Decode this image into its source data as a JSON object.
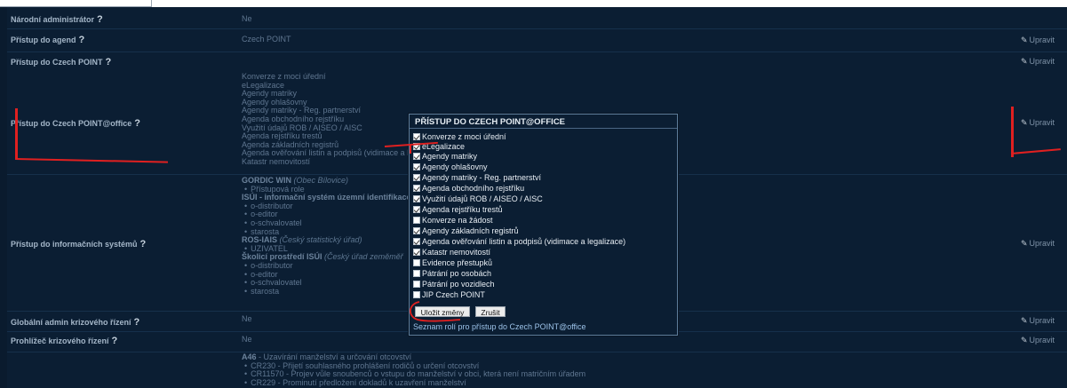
{
  "rows": {
    "narodni_admin": {
      "label": "Národní administrátor",
      "value": "Ne"
    },
    "pristup_agend": {
      "label": "Přístup do agend",
      "value": "Czech POINT",
      "edit": "Upravit"
    },
    "pristup_cp": {
      "label": "Přístup do Czech POINT",
      "edit": "Upravit"
    },
    "pristup_office": {
      "label": "Přístup do Czech POINT@office",
      "edit": "Upravit",
      "values": [
        "Konverze z moci úřední",
        "eLegalizace",
        "Agendy matriky",
        "Agendy ohlašovny",
        "Agendy matriky - Reg. partnerství",
        "Agenda obchodního rejstříku",
        "Využití údajů ROB / AISEO / AISC",
        "Agenda rejstříku trestů",
        "Agenda základních registrů",
        "Agenda ověřování listin a podpisů (vidimace a l",
        "Katastr nemovitostí"
      ]
    },
    "pristup_is": {
      "label": "Přístup do informačních systémů",
      "edit": "Upravit",
      "g1": {
        "name": "GORDIC WIN",
        "org": "(Obec Bílovice)",
        "items": [
          "Přístupová role"
        ]
      },
      "g2": {
        "name": "ISÚI - informační systém územní identifikace",
        "items": [
          "o-distributor",
          "o-editor",
          "o-schvalovatel",
          "starosta"
        ]
      },
      "g3": {
        "name": "ROS-IAIS",
        "org": "(Český statistický úřad)",
        "items": [
          "UZIVATEL"
        ]
      },
      "g4": {
        "name": "Školicí prostředí ISÚI",
        "org": "(Český úřad zeměměř",
        "items": [
          "o-distributor",
          "o-editor",
          "o-schvalovatel",
          "starosta"
        ]
      }
    },
    "global_admin": {
      "label": "Globální admin krizového řízení",
      "value": "Ne",
      "edit": "Upravit"
    },
    "prohlizec": {
      "label": "Prohlížeč krizového řízení",
      "value": "Ne",
      "edit": "Upravit"
    },
    "bottom": {
      "group": "A46",
      "group_desc": " - Uzavírání manželství a určování otcovství",
      "items": [
        "CR230 - Přijetí souhlasného prohlášení rodičů o určení otcovství",
        "CR11570 - Projev vůle snoubenců o vstupu do manželství v obci, která není matričním úřadem",
        "CR229 - Prominutí předložení dokladů k uzavření manželství"
      ]
    }
  },
  "modal": {
    "title": "PŘÍSTUP DO CZECH POINT@OFFICE",
    "options": [
      {
        "label": "Konverze z moci úřední",
        "checked": true
      },
      {
        "label": "eLegalizace",
        "checked": true
      },
      {
        "label": "Agendy matriky",
        "checked": true
      },
      {
        "label": "Agendy ohlašovny",
        "checked": true
      },
      {
        "label": "Agendy matriky - Reg. partnerství",
        "checked": true
      },
      {
        "label": "Agenda obchodního rejstříku",
        "checked": true
      },
      {
        "label": "Využití údajů ROB / AISEO / AISC",
        "checked": true
      },
      {
        "label": "Agenda rejstříku trestů",
        "checked": true
      },
      {
        "label": "Konverze na žádost",
        "checked": false
      },
      {
        "label": "Agendy základních registrů",
        "checked": true
      },
      {
        "label": "Agenda ověřování listin a podpisů (vidimace a legalizace)",
        "checked": true
      },
      {
        "label": "Katastr nemovitostí",
        "checked": true
      },
      {
        "label": "Evidence přestupků",
        "checked": false
      },
      {
        "label": "Pátrání po osobách",
        "checked": false
      },
      {
        "label": "Pátrání po vozidlech",
        "checked": false
      },
      {
        "label": "JIP Czech POINT",
        "checked": false
      }
    ],
    "save_label": "Uložit změny",
    "cancel_label": "Zrušit",
    "link": "Seznam rolí pro přístup do Czech POINT@office"
  },
  "question_mark": "?",
  "annotation_color": "#e02020"
}
